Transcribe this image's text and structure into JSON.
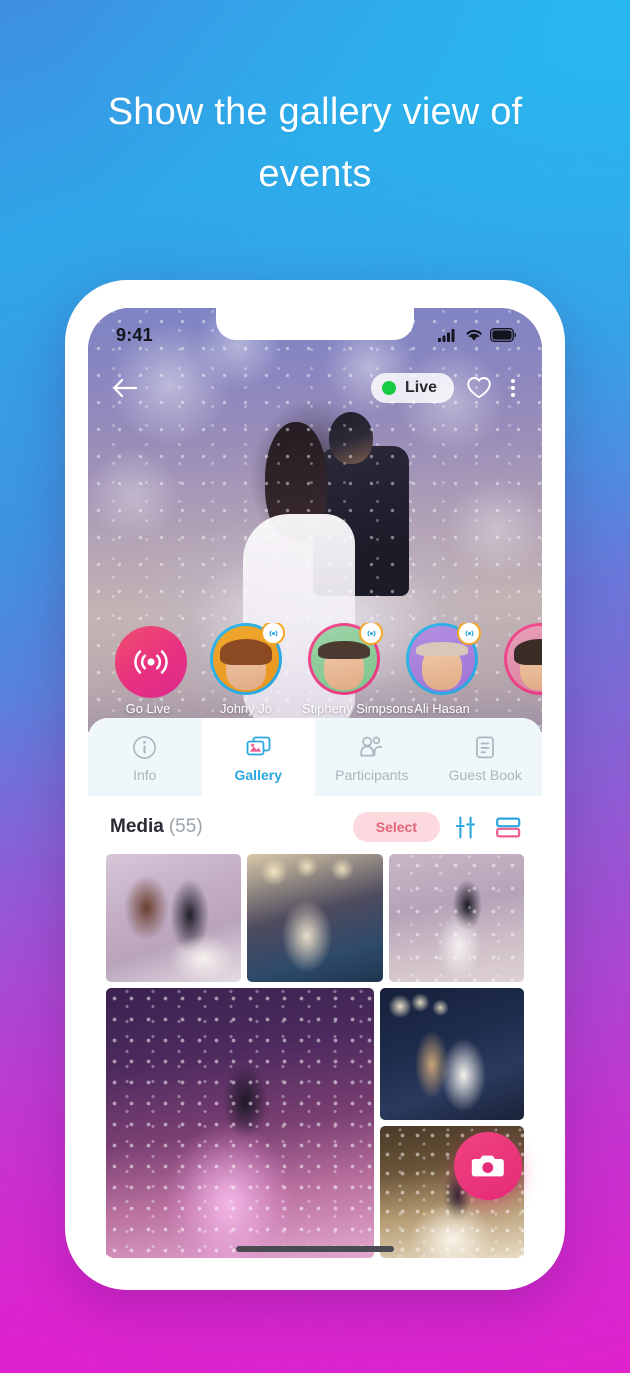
{
  "promo": {
    "headline": "Show the gallery view of events",
    "bg_top_color": "#3f8fe2",
    "bg_accent_color": "#27b0ea",
    "bg_bottom_color": "#df22cd"
  },
  "status_bar": {
    "time": "9:41",
    "signal_icon": "cellular-signal-icon",
    "wifi_icon": "wifi-icon",
    "battery_icon": "battery-icon"
  },
  "hero": {
    "back_icon": "back-arrow-icon",
    "live_label": "Live",
    "live_dot_color": "#18cb45",
    "favorite_icon": "heart-icon",
    "menu_icon": "more-vertical-icon"
  },
  "stories": {
    "go_live": {
      "label": "Go Live",
      "icon": "broadcast-icon",
      "color": "#e8317f"
    },
    "items": [
      {
        "name": "Johny Jo",
        "ring": "blue",
        "badge_icon": "broadcast-icon"
      },
      {
        "name": "Stipheny Simpsons",
        "ring": "pink",
        "badge_icon": "broadcast-icon"
      },
      {
        "name": "Ali Hasan",
        "ring": "blue",
        "badge_icon": "broadcast-icon"
      },
      {
        "name": "",
        "ring": "pink",
        "badge_icon": "broadcast-icon"
      }
    ]
  },
  "tabs": {
    "active_color": "#2ba6e0",
    "inactive_color": "#a9b6bd",
    "items": [
      {
        "label": "Info",
        "icon": "info-circle-icon",
        "active": false
      },
      {
        "label": "Gallery",
        "icon": "gallery-photos-icon",
        "active": true
      },
      {
        "label": "Participants",
        "icon": "participants-icon",
        "active": false
      },
      {
        "label": "Guest Book",
        "icon": "guest-book-icon",
        "active": false
      }
    ]
  },
  "media": {
    "title": "Media",
    "count": "(55)",
    "select_label": "Select",
    "select_bg_color": "#fbd9de",
    "select_text_color": "#e0657a",
    "filter_icon": "sliders-filter-icon",
    "layout_icon": "layout-rows-icon"
  },
  "gallery": {
    "row1": [
      {
        "alt": "bride-and-groom-cutting-cake",
        "style": "ph-cake"
      },
      {
        "alt": "guests-dancing-reception",
        "style": "ph-crowd"
      },
      {
        "alt": "first-dance-with-confetti",
        "style": "ph-confetti1"
      }
    ],
    "row2_large": {
      "alt": "bride-dancing-in-confetti-shower",
      "style": "ph-big"
    },
    "row2_right": [
      {
        "alt": "couple-dancing-city-night",
        "style": "ph-night"
      },
      {
        "alt": "couple-with-sparkler-fountains",
        "style": "ph-fire"
      }
    ]
  },
  "fab": {
    "icon": "camera-icon",
    "color": "#e52a77"
  },
  "home_indicator": "home-indicator-bar"
}
